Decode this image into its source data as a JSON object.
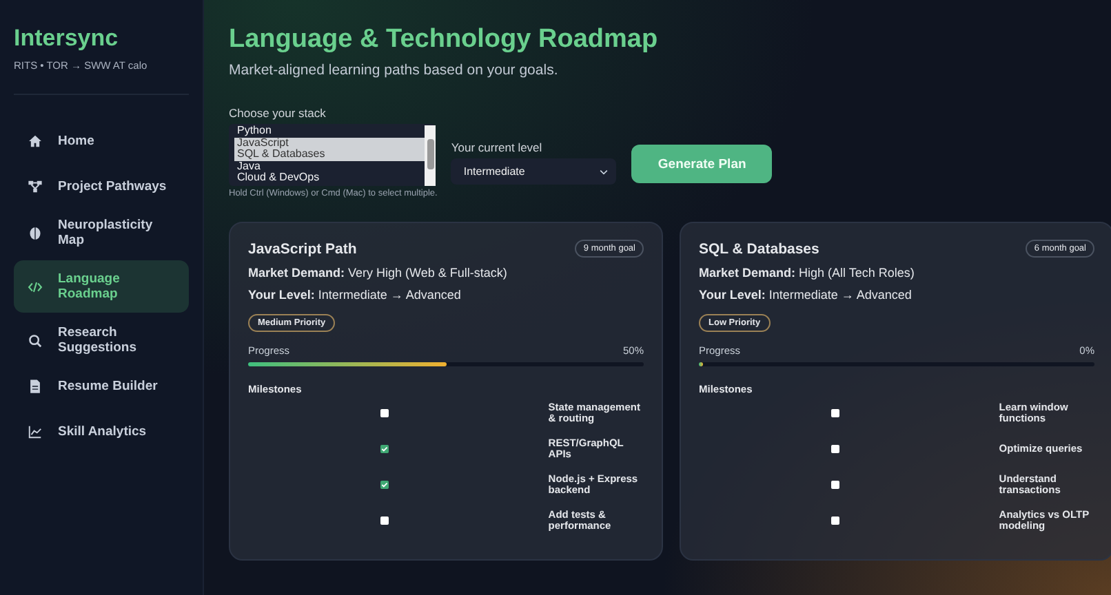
{
  "brand": {
    "name": "Intersync",
    "tagline": "RITS • TOR → SWW AT calo"
  },
  "nav": [
    {
      "label": "Home",
      "selected": false
    },
    {
      "label": "Project Pathways",
      "selected": false
    },
    {
      "label": "Neuroplasticity Map",
      "selected": false
    },
    {
      "label": "Language Roadmap",
      "selected": true
    },
    {
      "label": "Research Suggestions",
      "selected": false
    },
    {
      "label": "Resume Builder",
      "selected": false
    },
    {
      "label": "Skill Analytics",
      "selected": false
    }
  ],
  "header": {
    "title": "Language & Technology Roadmap",
    "subtitle": "Market-aligned learning paths based on your goals."
  },
  "stack": {
    "label": "Choose your stack",
    "options": [
      {
        "label": "Python",
        "selected": false
      },
      {
        "label": "JavaScript",
        "selected": true
      },
      {
        "label": "SQL & Databases",
        "selected": true
      },
      {
        "label": "Java",
        "selected": false
      },
      {
        "label": "Cloud & DevOps",
        "selected": false
      }
    ],
    "hint": "Hold Ctrl (Windows) or Cmd (Mac) to select multiple."
  },
  "level": {
    "label": "Your current level",
    "value": "Intermediate"
  },
  "generate_button": "Generate Plan",
  "cards": [
    {
      "title": "JavaScript Path",
      "goal": "9 month goal",
      "demand_label": "Market Demand:",
      "demand": "Very High (Web & Full-stack)",
      "level_label": "Your Level:",
      "level_text": "Intermediate → Advanced",
      "priority": "Medium Priority",
      "progress_label": "Progress",
      "progress": "50%",
      "level": 0.5,
      "milestones_label": "Milestones",
      "milestones": [
        {
          "label": "State management & routing",
          "checked": false
        },
        {
          "label": "REST/GraphQL APIs",
          "checked": true
        },
        {
          "label": "Node.js + Express backend",
          "checked": true
        },
        {
          "label": "Add tests & performance",
          "checked": false
        }
      ]
    },
    {
      "title": "SQL & Databases",
      "goal": "6 month goal",
      "demand_label": "Market Demand:",
      "demand": "High (All Tech Roles)",
      "level_label": "Your Level:",
      "level_text": "Intermediate → Advanced",
      "priority": "Low Priority",
      "progress_label": "Progress",
      "progress": "0%",
      "level": 0,
      "milestones_label": "Milestones",
      "milestones": [
        {
          "label": "Learn window functions",
          "checked": false
        },
        {
          "label": "Optimize queries",
          "checked": false
        },
        {
          "label": "Understand transactions",
          "checked": false
        },
        {
          "label": "Analytics vs OLTP modeling",
          "checked": false
        }
      ]
    }
  ]
}
